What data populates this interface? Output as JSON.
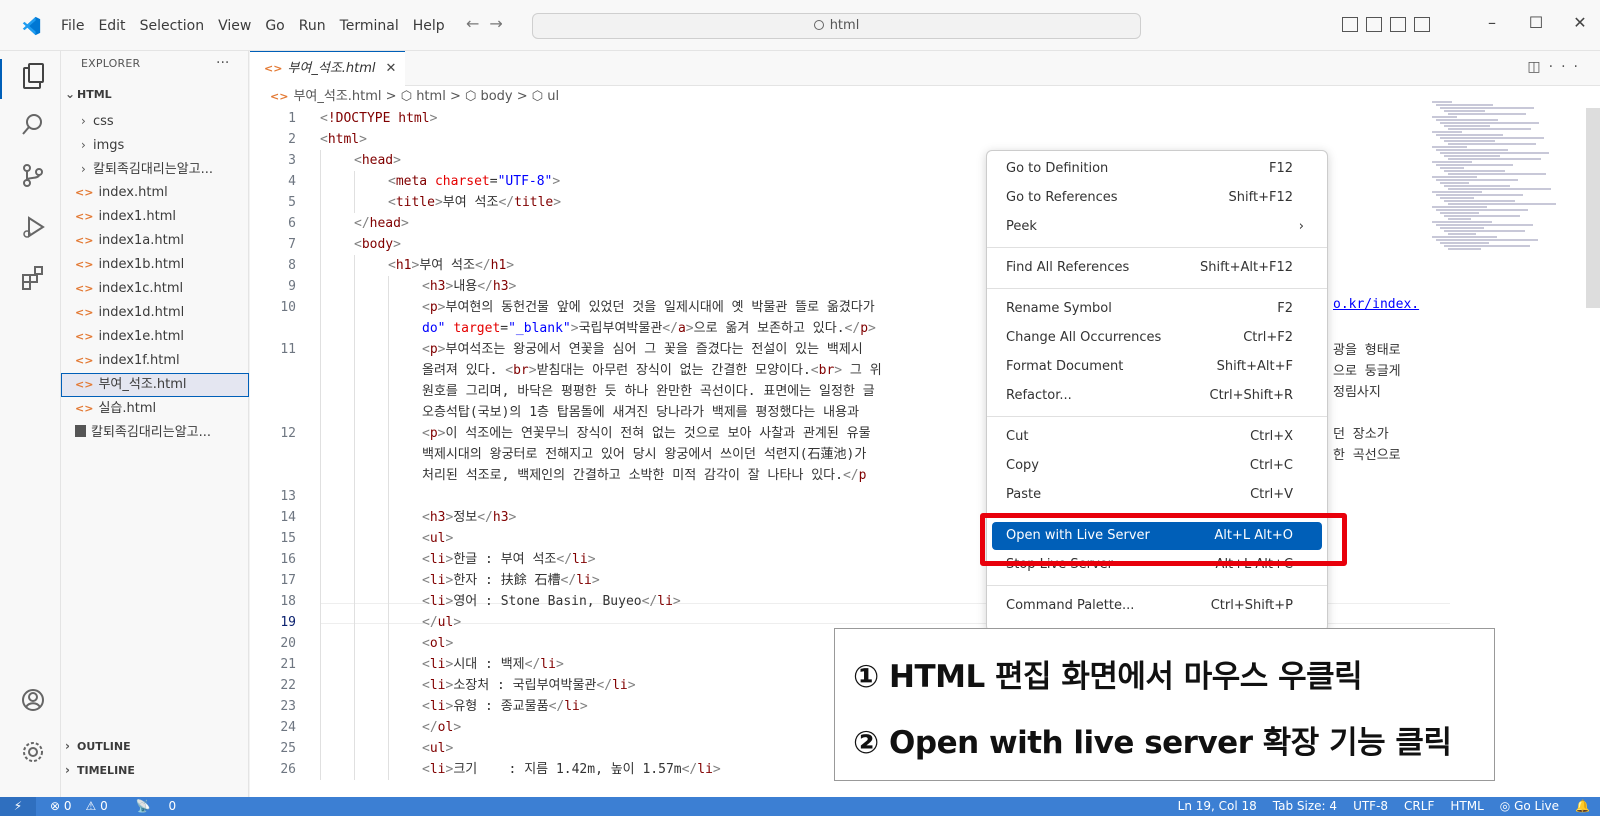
{
  "titlebar": {
    "menu": [
      "File",
      "Edit",
      "Selection",
      "View",
      "Go",
      "Run",
      "Terminal",
      "Help"
    ],
    "search_text": "html"
  },
  "sidebar": {
    "title": "EXPLORER",
    "more": "···",
    "root": "HTML",
    "items": [
      {
        "label": "css",
        "type": "folder"
      },
      {
        "label": "imgs",
        "type": "folder"
      },
      {
        "label": "칼퇴족김대리는알고...",
        "type": "folder"
      },
      {
        "label": "index.html",
        "type": "html"
      },
      {
        "label": "index1.html",
        "type": "html"
      },
      {
        "label": "index1a.html",
        "type": "html"
      },
      {
        "label": "index1b.html",
        "type": "html"
      },
      {
        "label": "index1c.html",
        "type": "html"
      },
      {
        "label": "index1d.html",
        "type": "html"
      },
      {
        "label": "index1e.html",
        "type": "html"
      },
      {
        "label": "index1f.html",
        "type": "html"
      },
      {
        "label": "부여_석조.html",
        "type": "html",
        "selected": true
      },
      {
        "label": "실습.html",
        "type": "html"
      },
      {
        "label": "칼퇴족김대리는알고...",
        "type": "file"
      }
    ],
    "outline": "OUTLINE",
    "timeline": "TIMELINE"
  },
  "editor": {
    "tab_label": "부여_석조.html",
    "tab_close": "✕",
    "breadcrumb": {
      "file": "부여_석조.html",
      "sep": ">",
      "parts": [
        "html",
        "body",
        "ul"
      ]
    },
    "lines": [
      {
        "n": "1",
        "indent": 0,
        "html": "<span class='b'>&lt;</span><span class='dt'>!DOCTYPE</span> <span class='t'>html</span><span class='b'>&gt;</span>"
      },
      {
        "n": "2",
        "indent": 0,
        "html": "<span class='b'>&lt;</span><span class='t'>html</span><span class='b'>&gt;</span>"
      },
      {
        "n": "3",
        "indent": 1,
        "html": "<span class='b'>&lt;</span><span class='t'>head</span><span class='b'>&gt;</span>"
      },
      {
        "n": "4",
        "indent": 2,
        "html": "<span class='b'>&lt;</span><span class='t'>meta</span> <span class='a'>charset</span>=<span class='v'>\"UTF-8\"</span><span class='b'>&gt;</span>"
      },
      {
        "n": "5",
        "indent": 2,
        "html": "<span class='b'>&lt;</span><span class='t'>title</span><span class='b'>&gt;</span>부여 석조<span class='b'>&lt;/</span><span class='t'>title</span><span class='b'>&gt;</span>"
      },
      {
        "n": "6",
        "indent": 1,
        "html": "<span class='b'>&lt;/</span><span class='t'>head</span><span class='b'>&gt;</span>"
      },
      {
        "n": "7",
        "indent": 1,
        "html": "<span class='b'>&lt;</span><span class='t'>body</span><span class='b'>&gt;</span>"
      },
      {
        "n": "8",
        "indent": 2,
        "html": "<span class='b'>&lt;</span><span class='t'>h1</span><span class='b'>&gt;</span>부여 석조<span class='b'>&lt;/</span><span class='t'>h1</span><span class='b'>&gt;</span>"
      },
      {
        "n": "9",
        "indent": 3,
        "html": "<span class='b'>&lt;</span><span class='t'>h3</span><span class='b'>&gt;</span>내용<span class='b'>&lt;/</span><span class='t'>h3</span><span class='b'>&gt;</span>"
      },
      {
        "n": "10",
        "indent": 3,
        "html": "<span class='b'>&lt;</span><span class='t'>p</span><span class='b'>&gt;</span>부여현의 동헌건물 앞에 있었던 것을 일제시대에 옛 박물관 뜰로 옮겼다가"
      },
      {
        "n": "",
        "indent": 3,
        "html": "<span class='v'>do\"</span> <span class='a'>target</span>=<span class='v'>\"_blank\"</span><span class='b'>&gt;</span>국립부여박물관<span class='b'>&lt;/</span><span class='t'>a</span><span class='b'>&gt;</span>으로 옮겨 보존하고 있다.<span class='b'>&lt;/</span><span class='t'>p</span><span class='b'>&gt;</span>"
      },
      {
        "n": "11",
        "indent": 3,
        "html": "<span class='b'>&lt;</span><span class='t'>p</span><span class='b'>&gt;</span>부여석조는 왕궁에서 연꽃을 심어 그 꽃을 즐겼다는 전설이 있는 백제시"
      },
      {
        "n": "",
        "indent": 3,
        "html": "올려져 있다. <span class='b'>&lt;</span><span class='t'>br</span><span class='b'>&gt;</span>받침대는 아무런 장식이 없는 간결한 모양이다.<span class='b'>&lt;</span><span class='t'>br</span><span class='b'>&gt;</span> 그 위"
      },
      {
        "n": "",
        "indent": 3,
        "html": "원호를 그리며, 바닥은 평평한 듯 하나 완만한 곡선이다. 표면에는 일정한 글"
      },
      {
        "n": "",
        "indent": 3,
        "html": "오층석탑(국보)의 1층 탑몸돌에 새겨진 당나라가 백제를 평정했다는 내용과"
      },
      {
        "n": "12",
        "indent": 3,
        "html": "<span class='b'>&lt;</span><span class='t'>p</span><span class='b'>&gt;</span>이 석조에는 연꽃무늬 장식이 전혀 없는 것으로 보아 사찰과 관계된 유물"
      },
      {
        "n": "",
        "indent": 3,
        "html": "백제시대의 왕궁터로 전해지고 있어 당시 왕궁에서 쓰이던 석련지(石蓮池)가"
      },
      {
        "n": "",
        "indent": 3,
        "html": "처리된 석조로, 백제인의 간결하고 소박한 미적 감각이 잘 나타나 있다.<span class='b'>&lt;/</span><span class='t'>p</span>"
      },
      {
        "n": "13",
        "indent": 3,
        "html": ""
      },
      {
        "n": "14",
        "indent": 3,
        "html": "<span class='b'>&lt;</span><span class='t'>h3</span><span class='b'>&gt;</span>정보<span class='b'>&lt;/</span><span class='t'>h3</span><span class='b'>&gt;</span>"
      },
      {
        "n": "15",
        "indent": 3,
        "html": "<span class='b'>&lt;</span><span class='t'>ul</span><span class='b'>&gt;</span>"
      },
      {
        "n": "16",
        "indent": 3,
        "html": "<span class='b'>&lt;</span><span class='t'>li</span><span class='b'>&gt;</span>한글 : 부여 석조<span class='b'>&lt;/</span><span class='t'>li</span><span class='b'>&gt;</span>"
      },
      {
        "n": "17",
        "indent": 3,
        "html": "<span class='b'>&lt;</span><span class='t'>li</span><span class='b'>&gt;</span>한자 : 扶餘 石槽<span class='b'>&lt;/</span><span class='t'>li</span><span class='b'>&gt;</span>"
      },
      {
        "n": "18",
        "indent": 3,
        "html": "<span class='b'>&lt;</span><span class='t'>li</span><span class='b'>&gt;</span>영어 : Stone Basin, Buyeo<span class='b'>&lt;/</span><span class='t'>li</span><span class='b'>&gt;</span>"
      },
      {
        "n": "19",
        "indent": 3,
        "cur": true,
        "html": "<span class='b'>&lt;/</span><span class='t'>ul</span><span class='b'>&gt;</span>"
      },
      {
        "n": "20",
        "indent": 3,
        "html": "<span class='b'>&lt;</span><span class='t'>ol</span><span class='b'>&gt;</span>"
      },
      {
        "n": "21",
        "indent": 3,
        "html": "<span class='b'>&lt;</span><span class='t'>li</span><span class='b'>&gt;</span>시대 : 백제<span class='b'>&lt;/</span><span class='t'>li</span><span class='b'>&gt;</span>"
      },
      {
        "n": "22",
        "indent": 3,
        "html": "<span class='b'>&lt;</span><span class='t'>li</span><span class='b'>&gt;</span>소장처 : 국립부여박물관<span class='b'>&lt;/</span><span class='t'>li</span><span class='b'>&gt;</span>"
      },
      {
        "n": "23",
        "indent": 3,
        "html": "<span class='b'>&lt;</span><span class='t'>li</span><span class='b'>&gt;</span>유형 : 종교물품<span class='b'>&lt;/</span><span class='t'>li</span><span class='b'>&gt;</span>"
      },
      {
        "n": "24",
        "indent": 3,
        "html": "<span class='b'>&lt;/</span><span class='t'>ol</span><span class='b'>&gt;</span>"
      },
      {
        "n": "25",
        "indent": 3,
        "html": "<span class='b'>&lt;</span><span class='t'>ul</span><span class='b'>&gt;</span>"
      },
      {
        "n": "26",
        "indent": 3,
        "html": "<span class='b'>&lt;</span><span class='t'>li</span><span class='b'>&gt;</span>크기    : 지름 1.42m, 높이 1.57m<span class='b'>&lt;/</span><span class='t'>li</span><span class='b'>&gt;</span>"
      }
    ],
    "right_fragments": [
      "o.kr/index.",
      "광을 형태로",
      "으로 둥글게",
      "정림사지",
      "던 장소가",
      "한 곡선으로"
    ]
  },
  "context_menu": {
    "groups": [
      [
        {
          "label": "Go to Definition",
          "key": "F12"
        },
        {
          "label": "Go to References",
          "key": "Shift+F12"
        },
        {
          "label": "Peek",
          "key": "",
          "submenu": true
        }
      ],
      [
        {
          "label": "Find All References",
          "key": "Shift+Alt+F12"
        }
      ],
      [
        {
          "label": "Rename Symbol",
          "key": "F2"
        },
        {
          "label": "Change All Occurrences",
          "key": "Ctrl+F2"
        },
        {
          "label": "Format Document",
          "key": "Shift+Alt+F"
        },
        {
          "label": "Refactor...",
          "key": "Ctrl+Shift+R"
        }
      ],
      [
        {
          "label": "Cut",
          "key": "Ctrl+X"
        },
        {
          "label": "Copy",
          "key": "Ctrl+C"
        },
        {
          "label": "Paste",
          "key": "Ctrl+V"
        }
      ],
      [
        {
          "label": "Open with Live Server",
          "key": "Alt+L Alt+O",
          "active": true
        },
        {
          "label": "Stop Live Server",
          "key": "Alt+L Alt+C"
        }
      ],
      [
        {
          "label": "Command Palette...",
          "key": "Ctrl+Shift+P"
        }
      ]
    ]
  },
  "callout": {
    "line1": "① HTML 편집 화면에서 마우스 우클릭",
    "line2": "② Open with live server 확장 기능 클릭"
  },
  "statusbar": {
    "errors": "⊗ 0",
    "warnings": "⚠ 0",
    "ports": "0",
    "position": "Ln 19, Col 18",
    "tab_size": "Tab Size: 4",
    "encoding": "UTF-8",
    "eol": "CRLF",
    "language": "HTML",
    "go_live": "Go Live"
  },
  "colors": {
    "accent": "#005fb8",
    "statusbar": "#3c7fd3",
    "highlight_box": "#e8000b"
  }
}
